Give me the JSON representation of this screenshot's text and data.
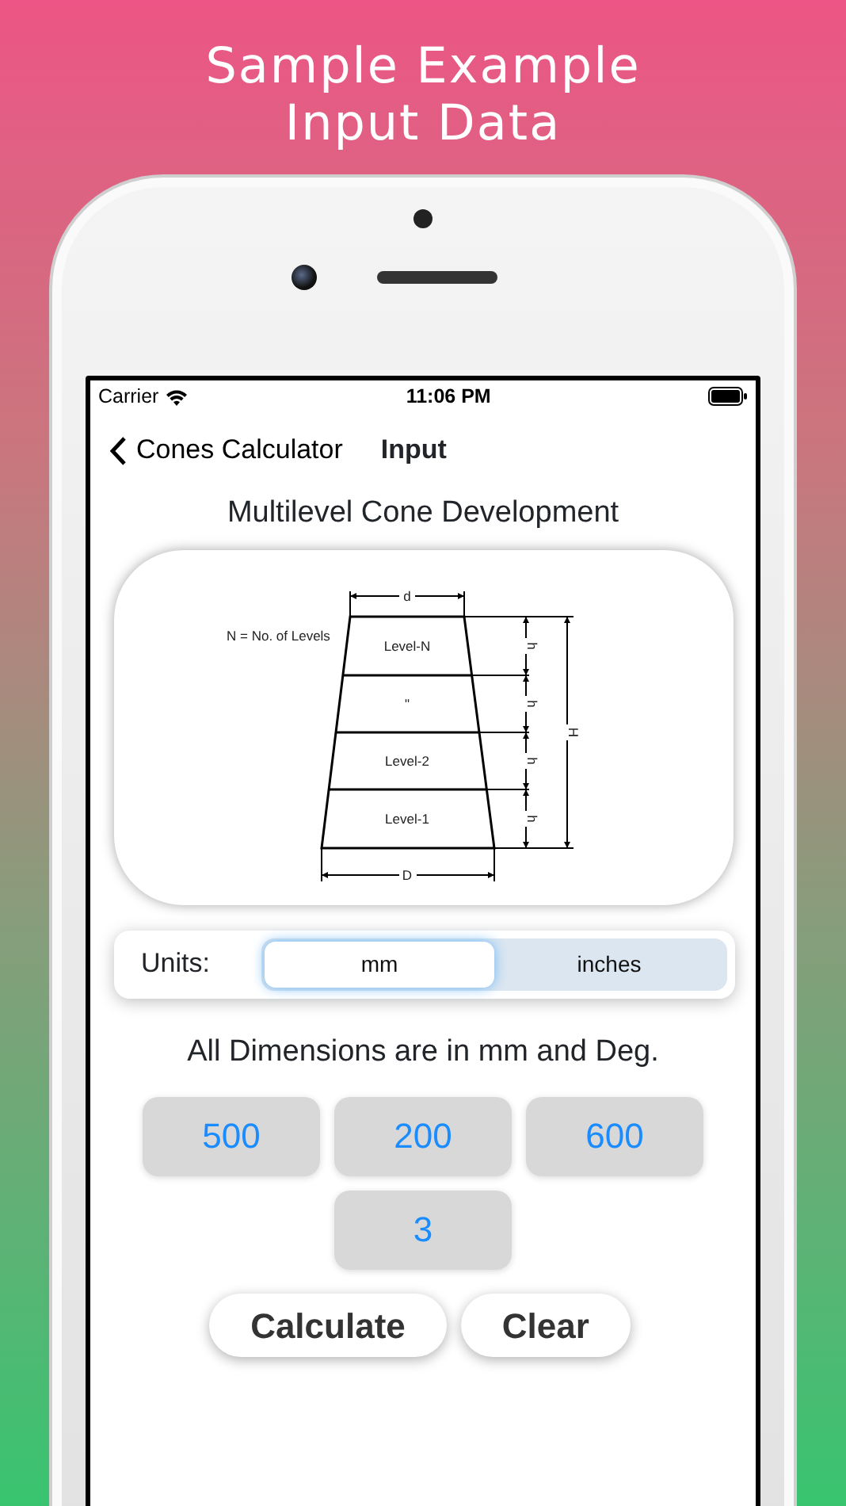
{
  "headline": [
    "Sample Example",
    "Input Data"
  ],
  "status_bar": {
    "carrier": "Carrier",
    "time": "11:06 PM"
  },
  "nav": {
    "back": "Cones Calculator",
    "title": "Input"
  },
  "page_title": "Multilevel Cone Development",
  "diagram": {
    "note": "N = No. of Levels",
    "top_label": "d",
    "bottom_label": "D",
    "height_label": "H",
    "levels": [
      {
        "label": "Level-N",
        "height_label": "h"
      },
      {
        "label": "\"",
        "height_label": "h"
      },
      {
        "label": "Level-2",
        "height_label": "h"
      },
      {
        "label": "Level-1",
        "height_label": "h"
      }
    ]
  },
  "units": {
    "label": "Units:",
    "options": [
      {
        "label": "mm",
        "selected": true
      },
      {
        "label": "inches",
        "selected": false
      }
    ]
  },
  "dimensions_note": "All Dimensions are in mm and Deg.",
  "fields": [
    {
      "value": "500"
    },
    {
      "value": "200"
    },
    {
      "value": "600"
    },
    {
      "value": "3"
    }
  ],
  "buttons": [
    "Calculate",
    "Clear"
  ]
}
